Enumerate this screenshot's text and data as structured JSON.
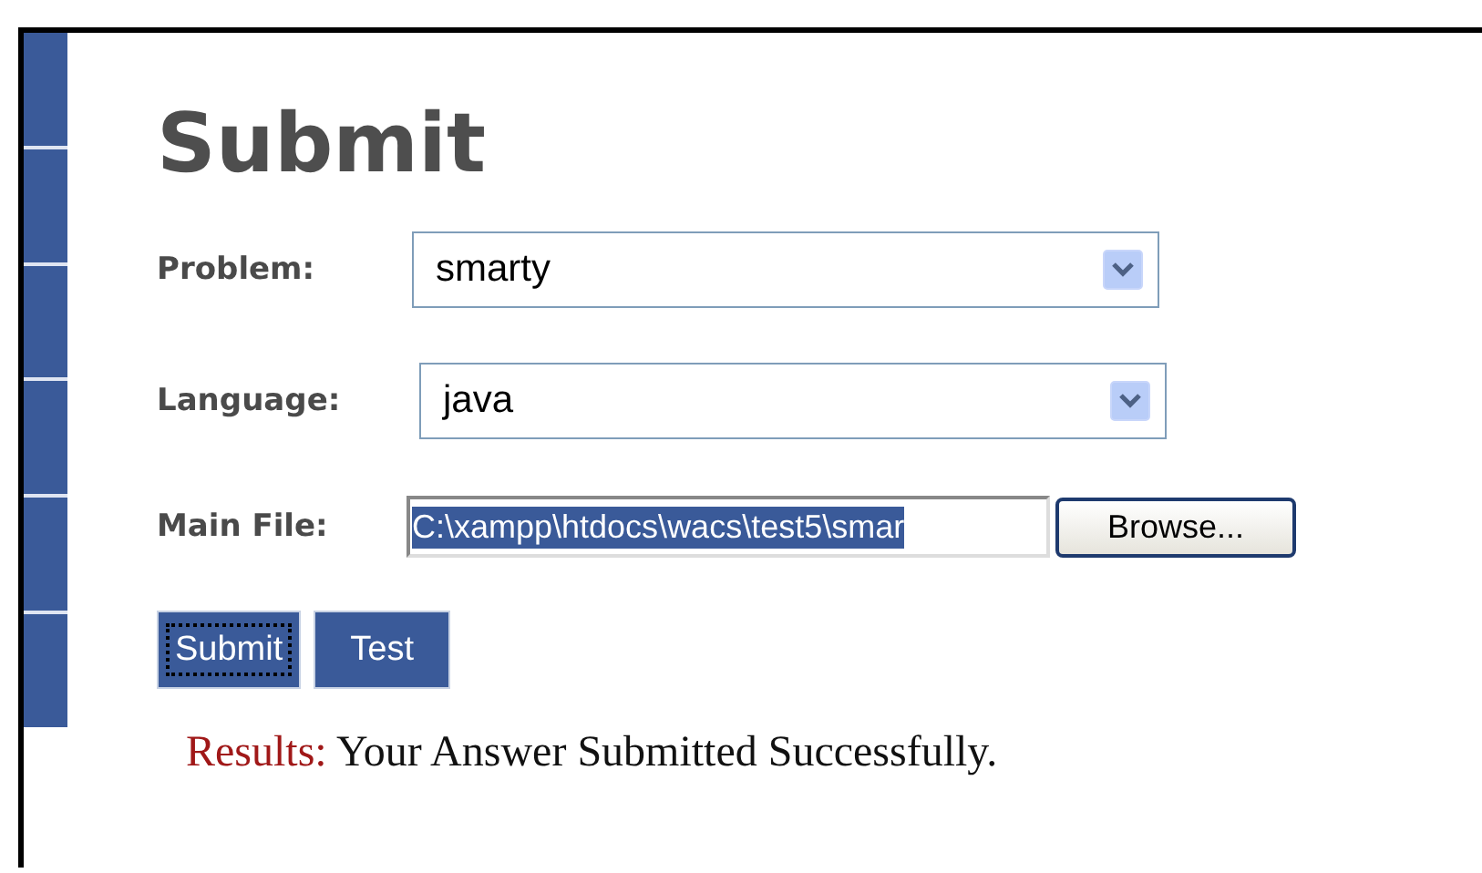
{
  "heading": "Submit",
  "fields": [
    {
      "kind": "select",
      "label": "Problem:",
      "value": "smarty"
    },
    {
      "kind": "select",
      "label": "Language:",
      "value": "java"
    },
    {
      "kind": "file",
      "label": "Main File:",
      "value": "C:\\xampp\\htdocs\\wacs\\test5\\smar",
      "text_selected": true,
      "button": "Browse..."
    }
  ],
  "buttons": [
    {
      "label": "Submit",
      "focused": true
    },
    {
      "label": "Test",
      "focused": false
    }
  ],
  "result": {
    "label": "Results:",
    "message": "Your Answer Submitted Successfully."
  }
}
